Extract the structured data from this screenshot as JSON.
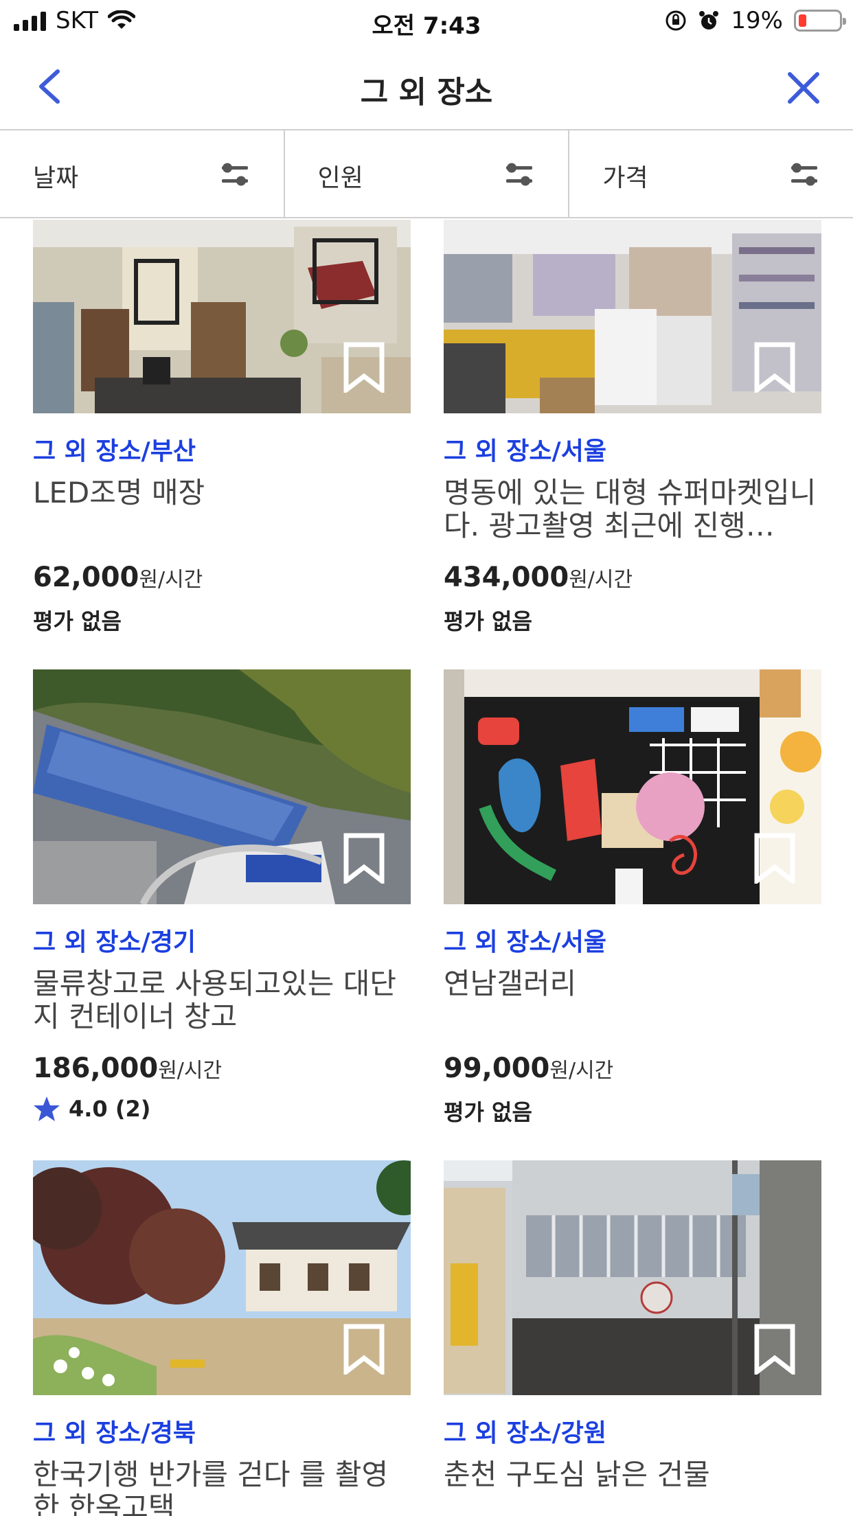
{
  "status_bar": {
    "carrier": "SKT",
    "time": "오전 7:43",
    "battery": "19%",
    "battery_level": 0.19
  },
  "nav": {
    "title": "그 외 장소",
    "back_icon": "chevron-left-icon",
    "close_icon": "close-icon"
  },
  "filters": [
    {
      "label": "날짜",
      "icon": "filter-sliders-icon"
    },
    {
      "label": "인원",
      "icon": "filter-sliders-icon"
    },
    {
      "label": "가격",
      "icon": "filter-sliders-icon"
    }
  ],
  "colors": {
    "accent": "#1b3fe0",
    "nav_icon": "#3d5bd9",
    "battery_low": "#ff3b30"
  },
  "listings": [
    {
      "category": "그 외 장소/부산",
      "title": "LED조명 매장",
      "price": "62,000",
      "unit": "원/시간",
      "rating": "평가 없음"
    },
    {
      "category": "그 외 장소/서울",
      "title": "명동에 있는 대형 슈퍼마켓입니다. 광고촬영 최근에 진행…",
      "price": "434,000",
      "unit": "원/시간",
      "rating": "평가 없음"
    },
    {
      "category": "그 외 장소/경기",
      "title": "물류창고로 사용되고있는 대단지 컨테이너 창고",
      "price": "186,000",
      "unit": "원/시간",
      "rating": "4.0 (2)",
      "rating_stars": 4.0
    },
    {
      "category": "그 외 장소/서울",
      "title": "연남갤러리",
      "price": "99,000",
      "unit": "원/시간",
      "rating": "평가 없음"
    },
    {
      "category": "그 외 장소/경북",
      "title": "한국기행 반가를 걷다 를 촬영한 한옥고택"
    },
    {
      "category": "그 외 장소/강원",
      "title": "춘천 구도심 낡은 건물"
    }
  ]
}
